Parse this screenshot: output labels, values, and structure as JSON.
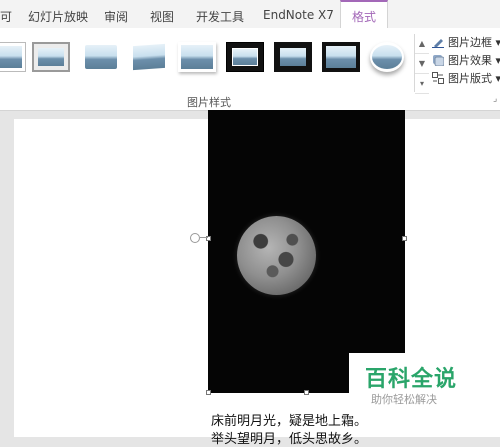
{
  "tabs": [
    "幻灯片放映",
    "审阅",
    "视图",
    "开发工具",
    "EndNote X7",
    "格式"
  ],
  "tab_partial": "可",
  "active_tab": "格式",
  "accent_color": "#a368b8",
  "ribbon": {
    "picture_styles_group_label": "图片样式",
    "buttons": {
      "picture_border": "图片边框",
      "picture_effects": "图片效果",
      "picture_layout": "图片版式"
    },
    "gallery_icons": [
      "thumbnail-style-1",
      "thumbnail-style-2",
      "thumbnail-style-3",
      "thumbnail-style-4",
      "thumbnail-style-5",
      "thumbnail-style-6",
      "thumbnail-style-7",
      "thumbnail-style-8",
      "thumbnail-style-9"
    ]
  },
  "slide": {
    "image": "moon-photo",
    "poem_line1": "床前明月光，疑是地上霜。",
    "poem_line2": "举头望明月，低头思故乡。"
  },
  "watermark": {
    "title": "百科全说",
    "subtitle": "助你轻松解决"
  }
}
